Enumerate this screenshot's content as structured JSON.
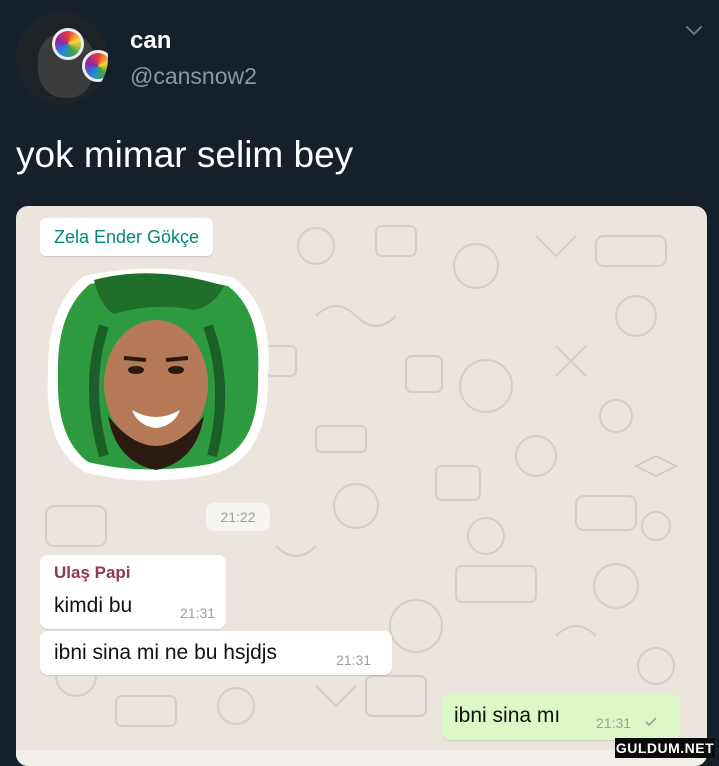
{
  "tweet": {
    "author_name": "can",
    "author_handle": "@cansnow2",
    "text": "yok mimar selim bey"
  },
  "chat": {
    "sticker_sender": "Zela Ender Gökçe",
    "sticker_time": "21:22",
    "messages": [
      {
        "sender": "Ulaş Papi",
        "text": "kimdi bu",
        "time": "21:31"
      },
      {
        "sender": "",
        "text": "ibni sina mi ne bu hsjdjs",
        "time": "21:31"
      }
    ],
    "outgoing": {
      "text": "ibni sina mı",
      "time": "21:31",
      "status_icon": "single-check-icon"
    }
  },
  "watermark": "GULDUM.NET",
  "colors": {
    "background": "#15202b",
    "handle": "#8899a6",
    "chat_bg": "#ece5dd",
    "sender_teal": "#00897b",
    "sender_maroon": "#8e3a52",
    "outgoing_bubble": "#dcf8c6"
  }
}
